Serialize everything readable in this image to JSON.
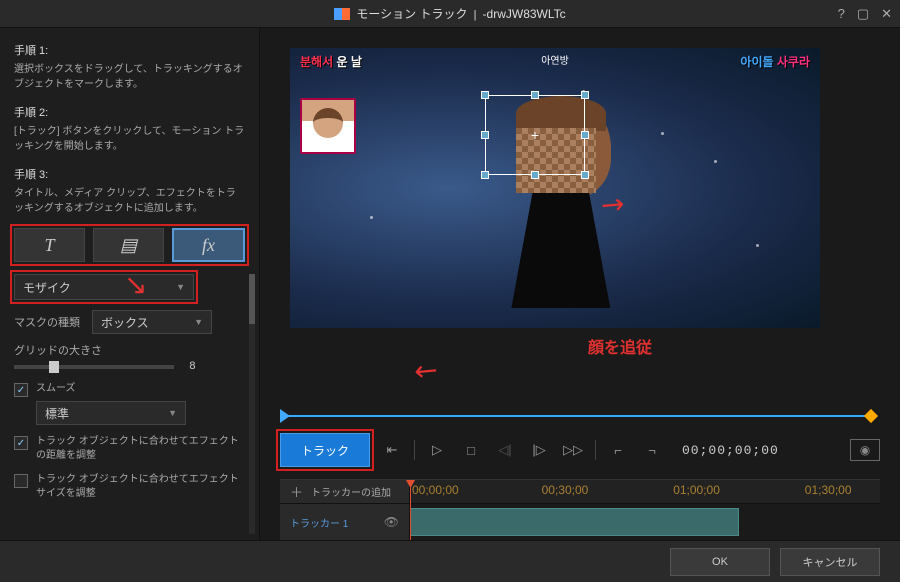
{
  "titlebar": {
    "app": "モーション トラック",
    "filename": "-drwJW83WLTc"
  },
  "steps": {
    "s1": {
      "heading": "手順 1:",
      "text": "選択ボックスをドラッグして、トラッキングするオブジェクトをマークします。"
    },
    "s2": {
      "heading": "手順 2:",
      "text": "[トラック] ボタンをクリックして、モーション トラッキングを開始します。"
    },
    "s3": {
      "heading": "手順 3:",
      "text": "タイトル、メディア クリップ、エフェクトをトラッキングするオブジェクトに追加します。"
    }
  },
  "fxbar": {
    "text_btn": "T",
    "media_btn": "▤",
    "fx_btn": "fx"
  },
  "effect": {
    "selected": "モザイク",
    "mask_label": "マスクの種類",
    "mask_value": "ボックス",
    "grid_label": "グリッドの大きさ",
    "grid_value": "8",
    "smooth_label": "スムーズ",
    "smooth_value": "標準",
    "adjust_dist_label": "トラック オブジェクトに合わせてエフェクトの距離を調整",
    "adjust_size_label": "トラック オブジェクトに合わせてエフェクト サイズを調整"
  },
  "preview": {
    "banner_left_a": "분해서 ",
    "banner_left_b": "운 날",
    "banner_right_a": "아이돌 ",
    "banner_right_b": "사쿠라",
    "banner_top": "아연방",
    "instruction": "顔を追従"
  },
  "controls": {
    "track_btn": "トラック",
    "timecode": "00;00;00;00"
  },
  "timeline": {
    "add_tracker": "トラッカーの追加",
    "tracker1": "トラッカー 1",
    "times": [
      "00;00;00",
      "00;30;00",
      "01;00;00",
      "01;30;00"
    ]
  },
  "footer": {
    "ok": "OK",
    "cancel": "キャンセル"
  }
}
